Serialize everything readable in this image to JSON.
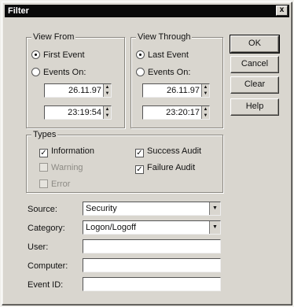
{
  "window": {
    "title": "Filter",
    "close_glyph": "x"
  },
  "view_from": {
    "group_label": "View From",
    "first_event_label": "First Event",
    "events_on_label": "Events On:",
    "date": "26.11.97",
    "time": "23:19:54",
    "selected": "first_event"
  },
  "view_through": {
    "group_label": "View Through",
    "last_event_label": "Last Event",
    "events_on_label": "Events On:",
    "date": "26.11.97",
    "time": "23:20:17",
    "selected": "last_event"
  },
  "buttons": {
    "ok": "OK",
    "cancel": "Cancel",
    "clear": "Clear",
    "help": "Help"
  },
  "types": {
    "group_label": "Types",
    "items": [
      {
        "label": "Information",
        "checked": true,
        "enabled": true
      },
      {
        "label": "Warning",
        "checked": false,
        "enabled": false
      },
      {
        "label": "Error",
        "checked": false,
        "enabled": false
      },
      {
        "label": "Success Audit",
        "checked": true,
        "enabled": true
      },
      {
        "label": "Failure Audit",
        "checked": true,
        "enabled": true
      }
    ]
  },
  "fields": {
    "source": {
      "label": "Source:",
      "value": "Security"
    },
    "category": {
      "label": "Category:",
      "value": "Logon/Logoff"
    },
    "user": {
      "label": "User:",
      "value": ""
    },
    "computer": {
      "label": "Computer:",
      "value": ""
    },
    "event_id": {
      "label": "Event ID:",
      "value": ""
    }
  },
  "icons": {
    "check": "✓",
    "spin_up": "▲",
    "spin_down": "▼",
    "dropdown": "▼"
  }
}
